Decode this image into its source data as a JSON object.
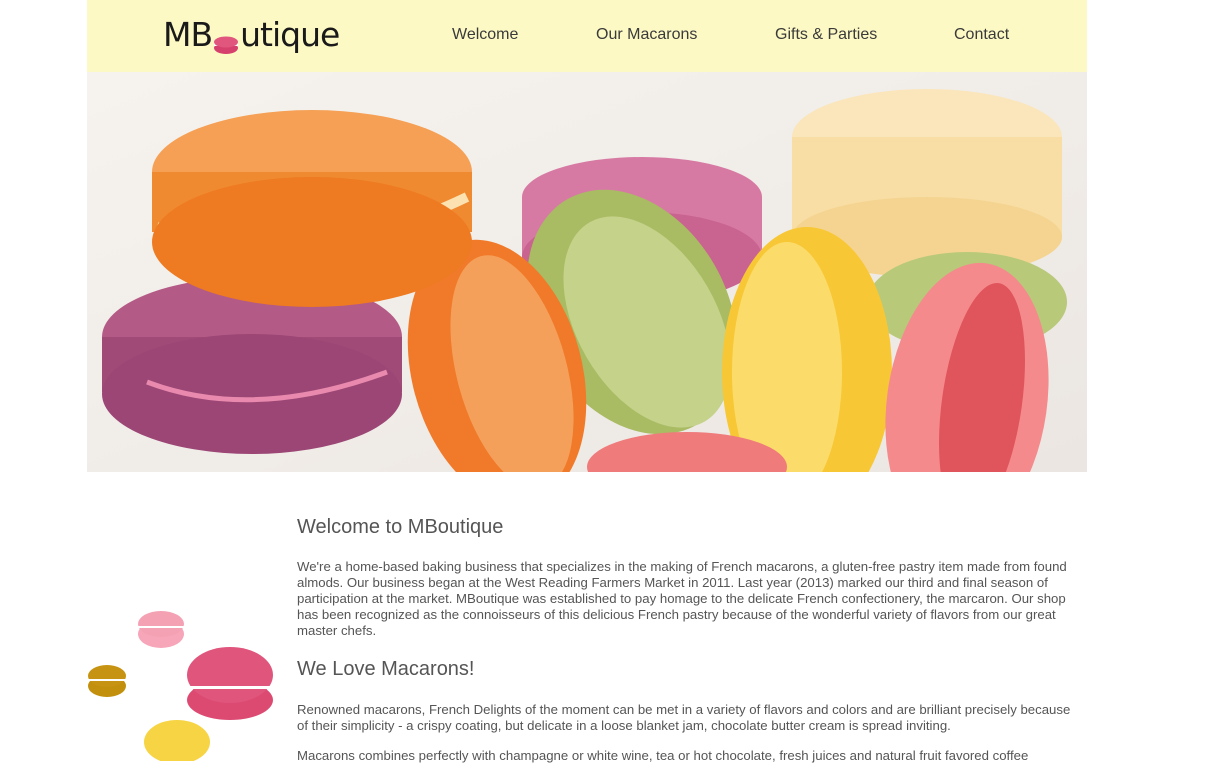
{
  "header": {
    "logo_prefix": "MB",
    "logo_suffix": "utique",
    "nav": [
      "Welcome",
      "Our Macarons",
      "Gifts & Parties",
      "Contact"
    ]
  },
  "hero": {
    "image": "macarons-photo"
  },
  "welcome": {
    "title": "Welcome to MBoutique",
    "body": "We're a home-based baking business that specializes in the making of French macarons, a gluten-free pastry item made from found almods. Our business began at the West Reading Farmers Market in 2011. Last year (2013) marked our third and final season of participation at the market. MBoutique was established to pay homage to the delicate French confectionery, the marcaron. Our shop has been recognized as the connoisseurs of this delicious French pastry because of the wonderful variety of flavors from our great master chefs."
  },
  "love": {
    "title": "We Love Macarons!",
    "body1": "Renowned macarons, French Delights of the moment can be met in a variety of flavors and colors and are brilliant precisely because of their simplicity - a crispy coating, but delicate in a loose blanket jam, chocolate butter cream is spread inviting.",
    "body2": "Macarons combines perfectly with champagne or white wine, tea or hot chocolate, fresh juices and natural fruit favored coffee"
  },
  "colors": {
    "header_bg": "#fdf9c4",
    "text": "#555555",
    "accent_pink": "#e0567c"
  }
}
